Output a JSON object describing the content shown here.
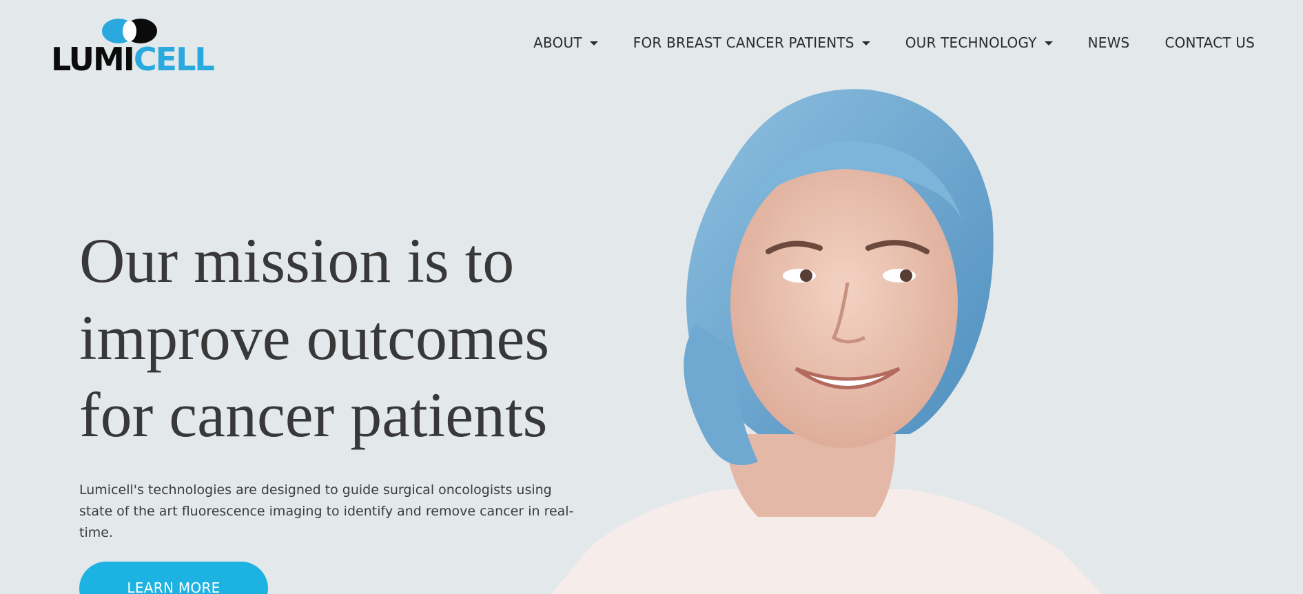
{
  "brand": {
    "name_part1": "LUMI",
    "name_part2": "CELL",
    "logo_icon": "eye-oval-icon",
    "colors": {
      "dark": "#0b0b0b",
      "accent": "#2aa9df"
    }
  },
  "nav": {
    "items": [
      {
        "label": "ABOUT",
        "has_dropdown": true
      },
      {
        "label": "FOR BREAST CANCER PATIENTS",
        "has_dropdown": true
      },
      {
        "label": "OUR TECHNOLOGY",
        "has_dropdown": true
      },
      {
        "label": "NEWS",
        "has_dropdown": false
      },
      {
        "label": "CONTACT US",
        "has_dropdown": false
      }
    ]
  },
  "hero": {
    "headline_lines": [
      "Our mission is to",
      "improve outcomes",
      "for cancer patients"
    ],
    "description": "Lumicell's technologies are designed to guide surgical oncologists using state of the art fluorescence imaging to identify and remove cancer in real-time.",
    "cta_label": "LEARN MORE",
    "cta_color": "#1cb2e1",
    "background_color": "#e3e9eb"
  }
}
